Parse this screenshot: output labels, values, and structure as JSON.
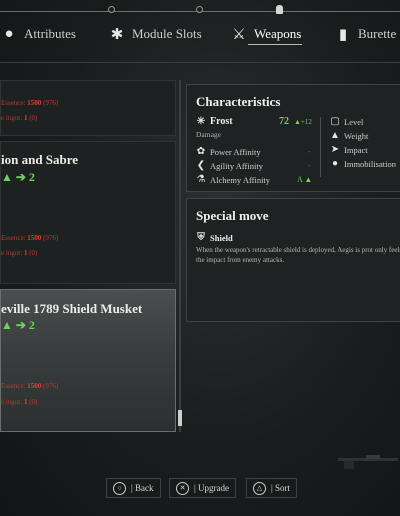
{
  "nav": {
    "tabs": [
      {
        "label": "Attributes",
        "icon": "character-icon"
      },
      {
        "label": "Module Slots",
        "icon": "module-icon"
      },
      {
        "label": "Weapons",
        "icon": "weapon-icon",
        "active": true
      },
      {
        "label": "Burette",
        "icon": "burette-icon"
      }
    ]
  },
  "weapons": [
    {
      "name": "",
      "level": "",
      "lines": [
        {
          "prefix": " Essence: ",
          "value": "1500",
          "suffix": " (976)"
        },
        {
          "prefix": "e ingot: ",
          "value": "1",
          "suffix": " (0)"
        }
      ]
    },
    {
      "name": "ion and Sabre",
      "level": "▲ ➔ 2",
      "lines": [
        {
          "prefix": " Essence: ",
          "value": "1500",
          "suffix": " (976)"
        },
        {
          "prefix": "e ingot: ",
          "value": "1",
          "suffix": " (0)"
        }
      ]
    },
    {
      "name": "eville 1789 Shield Musket",
      "level": "▲ ➔ 2",
      "lines": [
        {
          "prefix": " Essence: ",
          "value": "1500",
          "suffix": " (976)"
        },
        {
          "prefix": "e ingot: ",
          "value": "1",
          "suffix": " (0)"
        }
      ]
    }
  ],
  "characteristics": {
    "title": "Characteristics",
    "element": "Frost",
    "damage_value": "72",
    "damage_bonus": "▲+12",
    "damage_label": "Damage",
    "left_stats": [
      {
        "label": "Power Affinity",
        "value": "-"
      },
      {
        "label": "Agility Affinity",
        "value": "-"
      },
      {
        "label": "Alchemy Affinity",
        "value": "A ▲"
      }
    ],
    "right_stats": [
      "Level",
      "Weight",
      "Impact",
      "Immobilisation"
    ]
  },
  "special_move": {
    "title": "Special move",
    "name": "Shield",
    "description": "When the weapon's retractable shield is deployed, Aegis is prot only feels the impact from enemy attacks."
  },
  "footer": {
    "back": "| Back",
    "upgrade": "| Upgrade",
    "sort": "| Sort"
  },
  "colors": {
    "accent_green": "#6fd35a",
    "cost_red": "#e0402f"
  }
}
